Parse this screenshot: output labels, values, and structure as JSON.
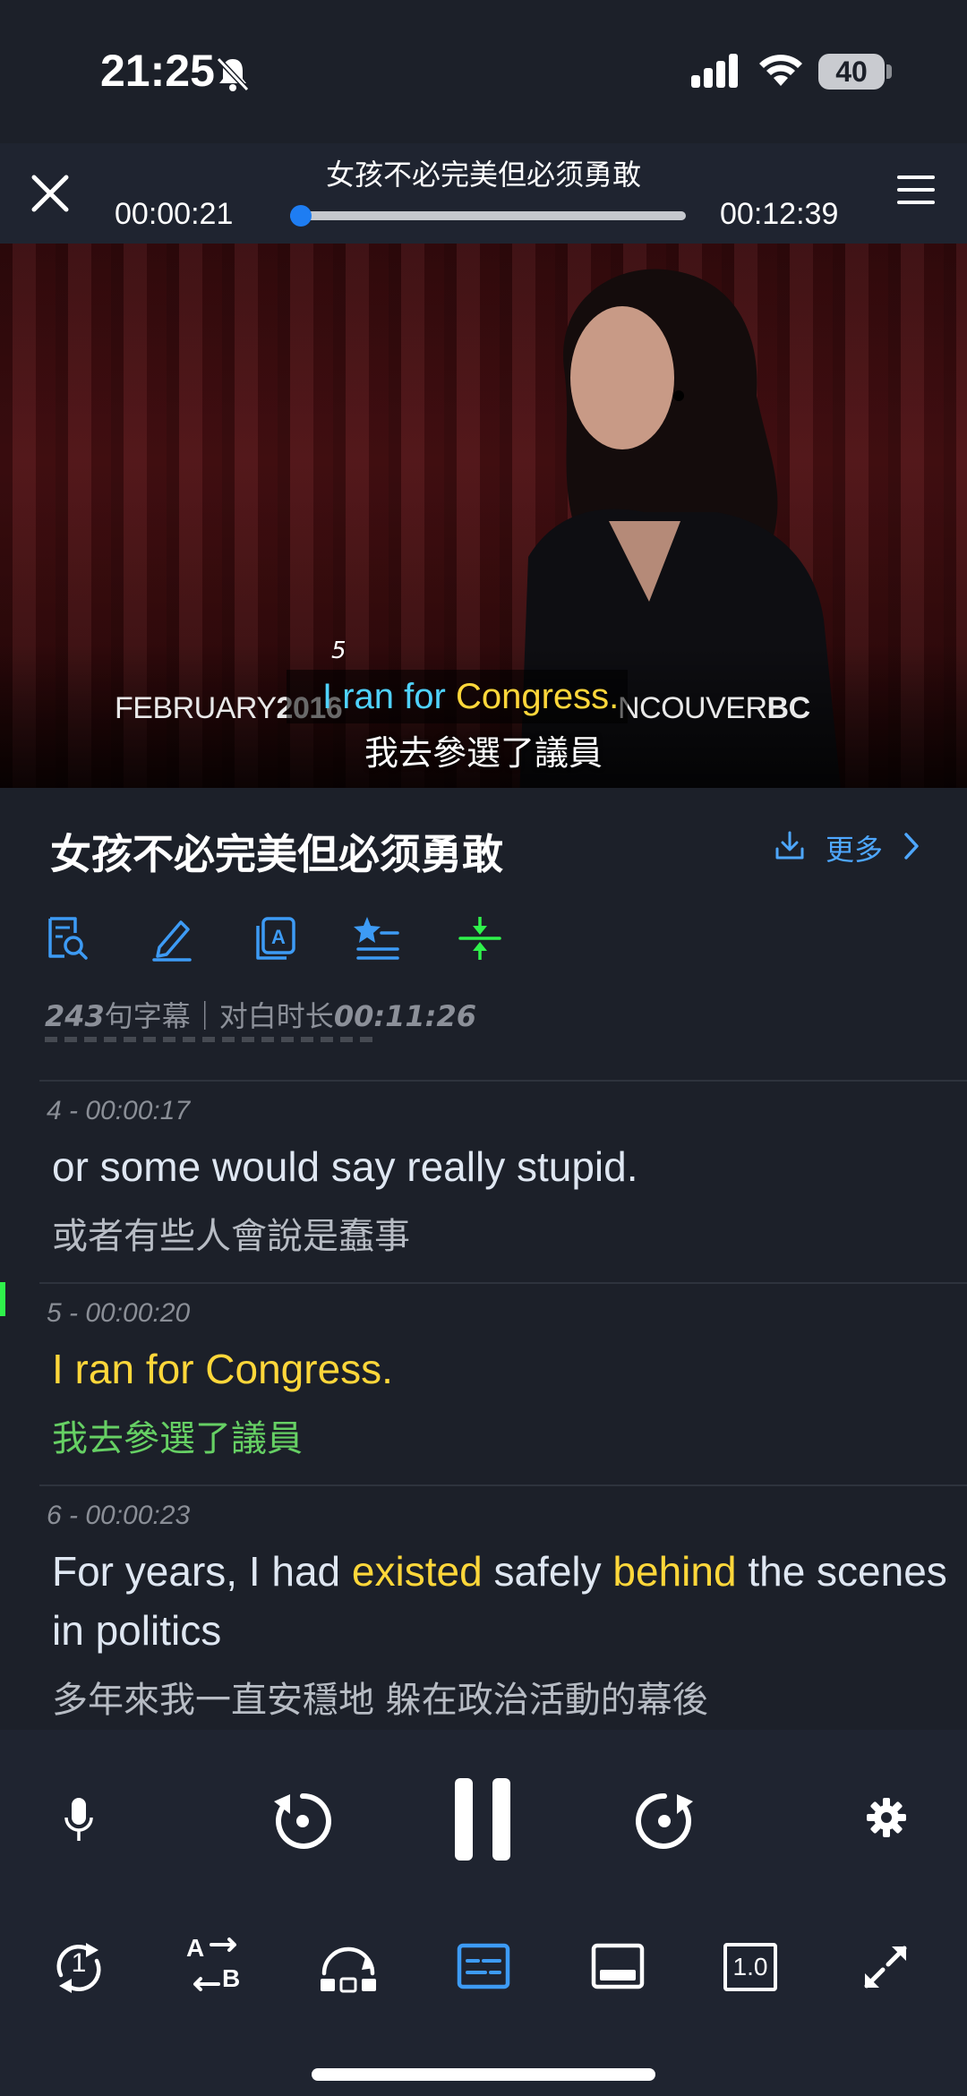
{
  "status": {
    "time": "21:25",
    "battery": "40",
    "icons": [
      "bell-slash-icon",
      "cellular-signal-icon",
      "wifi-icon",
      "battery-icon"
    ]
  },
  "player": {
    "title": "女孩不必完美但必须勇敢",
    "current_time": "00:00:21",
    "total_time": "00:12:39",
    "progress": 0.028
  },
  "video": {
    "watermark_left_thin": "FEBRUARY",
    "watermark_left_bold": "2016",
    "watermark_right_thin": "NCOUVER",
    "watermark_right_bold": "BC",
    "subtitle_index": "5",
    "subtitle_en_plain": "I ran for ",
    "subtitle_en_highlight": "Congress.",
    "subtitle_zh": "我去參選了議員"
  },
  "info": {
    "title": "女孩不必完美但必须勇敢",
    "more_label": "更多",
    "stats_count": "243",
    "stats_mid": "句字幕｜对白时长",
    "stats_duration": "00:11:26"
  },
  "subtitles": [
    {
      "meta": "4 - 00:00:17",
      "en_parts": [
        {
          "t": "or some would say really stupid.",
          "hl": false
        }
      ],
      "zh": "或者有些人會說是蠢事"
    },
    {
      "meta": "5 - 00:00:20",
      "en_parts": [
        {
          "t": "I ran for ",
          "hl": false
        },
        {
          "t": "Congress.",
          "hl": true
        }
      ],
      "zh": "我去參選了議員",
      "active": true
    },
    {
      "meta": "6 - 00:00:23",
      "en_parts": [
        {
          "t": "For years, I had ",
          "hl": false
        },
        {
          "t": "existed",
          "hl": true
        },
        {
          "t": " safely ",
          "hl": false
        },
        {
          "t": "behind",
          "hl": true
        },
        {
          "t": " the scenes in politics",
          "hl": false
        }
      ],
      "zh": "多年來我一直安穩地 躲在政治活動的幕後"
    }
  ],
  "controls": {
    "speed_label": "1.0",
    "loop_count": "1",
    "ab_a": "A",
    "ab_b": "B"
  },
  "colors": {
    "accent": "#1e7df2",
    "highlight": "#ffd73a",
    "active_zh": "#66d064",
    "tool_blue": "#3d9bf5",
    "tool_green": "#2ff24b"
  }
}
